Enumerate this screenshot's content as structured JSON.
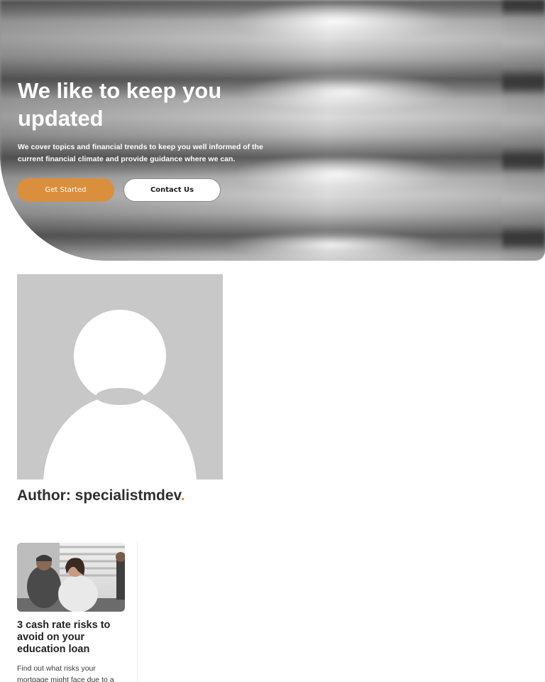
{
  "hero": {
    "title": "We like to keep you updated",
    "subtitle": "We cover topics and financial trends to keep you well informed of the current financial climate and provide guidance where we can.",
    "primary_button": "Get Started",
    "secondary_button": "Contact Us"
  },
  "author": {
    "label": "Author: specialistmdev",
    "dot": "."
  },
  "posts": [
    {
      "title": "3 cash rate risks to avoid on your education loan",
      "excerpt": "Find out what risks your mortgage might face due to a"
    }
  ],
  "colors": {
    "accent": "#d98f3c",
    "avatar_bg": "#c8c8c8"
  }
}
